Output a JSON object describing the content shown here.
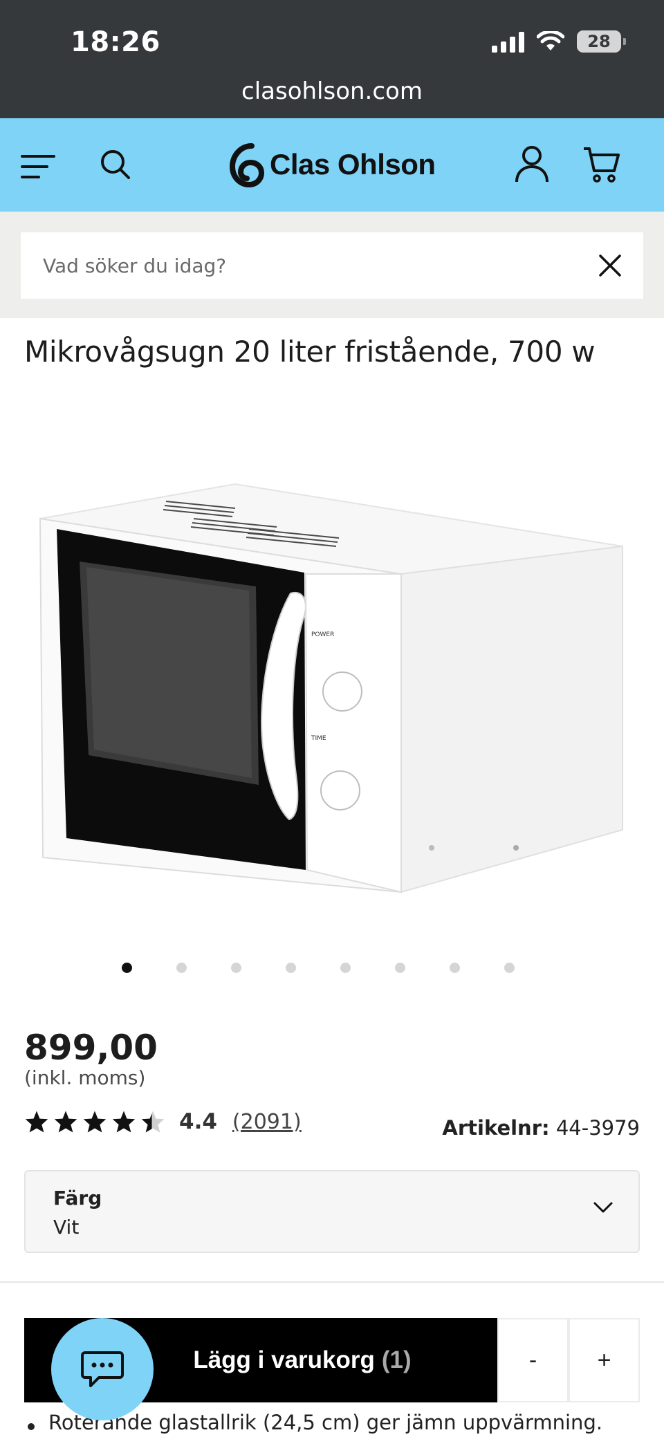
{
  "status": {
    "time": "18:26",
    "battery": "28",
    "url": "clasohlson.com"
  },
  "header": {
    "brand": "Clas Ohlson"
  },
  "search": {
    "placeholder": "Vad söker du idag?"
  },
  "product": {
    "title": "Mikrovågsugn 20 liter fristående, 700 w",
    "image_icon": "microwave-image",
    "gallery_total": 8,
    "gallery_active": 1,
    "price": "899,00",
    "price_note": "(inkl. moms)",
    "rating_value": "4.4",
    "rating_stars": 4.4,
    "rating_count": "(2091)",
    "article_label": "Artikelnr:",
    "article_number": "44-3979"
  },
  "color_select": {
    "label": "Färg",
    "value": "Vit"
  },
  "features": [
    "Roterande glastallrik (24,5 cm) ger jämn uppvärmning."
  ],
  "sticky_bar": {
    "add_to_cart": "Lägg i varukorg",
    "cart_count": "(1)",
    "minus": "-",
    "plus": "+"
  },
  "colors": {
    "header_bg": "#7fd3f7",
    "status_bg": "#35393c",
    "cta_bg": "#000000"
  }
}
